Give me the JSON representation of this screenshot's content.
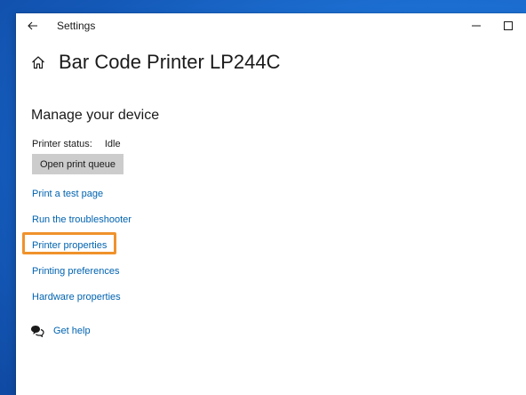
{
  "window": {
    "title": "Settings"
  },
  "page": {
    "title": "Bar Code Printer LP244C"
  },
  "device": {
    "section_title": "Manage your device",
    "status_label": "Printer status:",
    "status_value": "Idle",
    "open_queue_label": "Open print queue"
  },
  "links": [
    {
      "label": "Print a test page"
    },
    {
      "label": "Run the troubleshooter"
    },
    {
      "label": "Printer properties"
    },
    {
      "label": "Printing preferences"
    },
    {
      "label": "Hardware properties"
    }
  ],
  "help": {
    "label": "Get help"
  },
  "colors": {
    "link": "#0063b1",
    "highlight": "#f0922b",
    "button_bg": "#cccccc"
  },
  "icons": {
    "back": "back-arrow-icon",
    "minimize": "minimize-icon",
    "maximize": "maximize-icon",
    "home": "home-icon",
    "help": "help-chat-icon"
  }
}
